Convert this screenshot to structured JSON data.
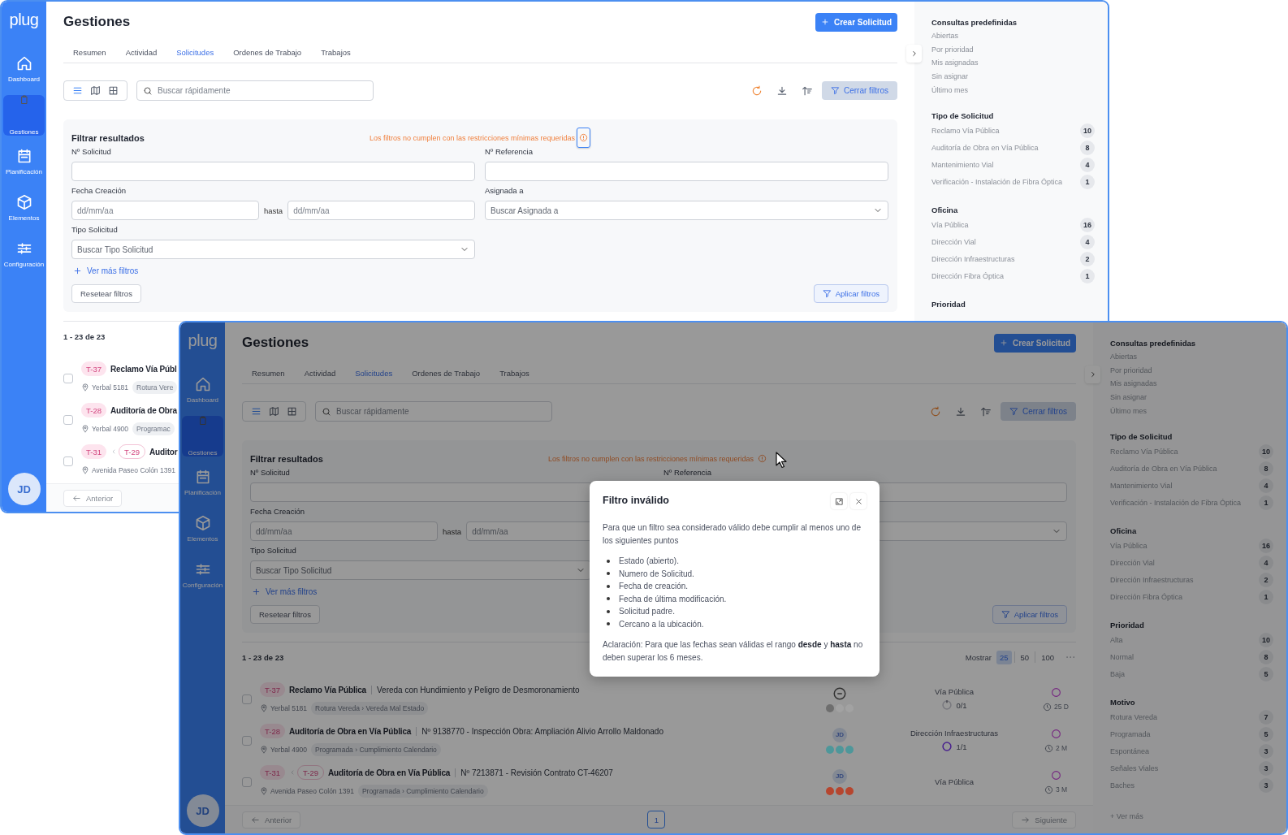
{
  "windows": [
    {
      "logo": "plug",
      "nav": [
        {
          "label": "Dashboard",
          "selected": false
        },
        {
          "label": "Gestiones",
          "selected": true
        },
        {
          "label": "Planificación",
          "selected": false
        },
        {
          "label": "Elementos",
          "selected": false
        },
        {
          "label": "Configuración",
          "selected": false
        }
      ],
      "avatar": "JD",
      "title": "Gestiones",
      "create_button": "Crear Solicitud",
      "tabs": [
        {
          "label": "Resumen",
          "selected": false
        },
        {
          "label": "Actividad",
          "selected": false
        },
        {
          "label": "Solicitudes",
          "selected": true
        },
        {
          "label": "Ordenes de Trabajo",
          "selected": false
        },
        {
          "label": "Trabajos",
          "selected": false
        }
      ],
      "search": {
        "placeholder": "Buscar rápidamente"
      },
      "filter_toggle": "Cerrar filtros",
      "filters": {
        "title": "Filtrar resultados",
        "warning": "Los filtros no cumplen con las restricciones mínimas requeridas",
        "warning_focused": true,
        "fields": [
          {
            "kind": "text",
            "label": "Nº Solicitud"
          },
          {
            "kind": "text",
            "label": "Nº Referencia"
          },
          {
            "kind": "date_range",
            "label": "Fecha Creación",
            "from_placeholder": "dd/mm/aa",
            "separator": "hasta",
            "to_placeholder": "dd/mm/aa"
          },
          {
            "kind": "select",
            "label": "Asignada a",
            "placeholder": "Buscar Asignada a"
          },
          {
            "kind": "select",
            "label": "Tipo Solicitud",
            "placeholder": "Buscar Tipo Solicitud"
          }
        ],
        "more": "Ver más filtros",
        "reset": "Resetear filtros",
        "apply": "Aplicar filtros"
      },
      "results": {
        "count": "1 - 23 de 23"
      },
      "rows": [
        {
          "checked": false,
          "tags": [
            {
              "label": "T-37",
              "kind": "own"
            }
          ],
          "title": "Reclamo Vía Públ",
          "location": "Yerbal 5181",
          "category": "Rotura Vere"
        },
        {
          "checked": false,
          "tags": [
            {
              "label": "T-28",
              "kind": "own"
            }
          ],
          "title": "Auditoría de Obra",
          "location": "Yerbal 4900",
          "category": "Programac"
        },
        {
          "checked": false,
          "tags": [
            {
              "label": "T-31",
              "kind": "own"
            },
            {
              "label": "T-29",
              "kind": "parent"
            }
          ],
          "title": "Auditor",
          "location": "Avenida Paseo Colón 1391"
        }
      ],
      "pagination": {
        "previous": {
          "label": "Anterior",
          "disabled": true
        }
      },
      "side_panel": {
        "sections": [
          {
            "title": "Consultas predefinidas",
            "items": [
              {
                "label": "Abiertas"
              },
              {
                "label": "Por prioridad"
              },
              {
                "label": "Mis asignadas"
              },
              {
                "label": "Sin asignar"
              },
              {
                "label": "Último mes"
              }
            ]
          },
          {
            "title": "Tipo de Solicitud",
            "items": [
              {
                "label": "Reclamo Vía Pública",
                "count": "10"
              },
              {
                "label": "Auditoría de Obra en Vía Pública",
                "count": "8"
              },
              {
                "label": "Mantenimiento Vial",
                "count": "4"
              },
              {
                "label": "Verificación - Instalación de Fibra Óptica",
                "count": "1"
              }
            ]
          },
          {
            "title": "Oficina",
            "items": [
              {
                "label": "Vía Pública",
                "count": "16"
              },
              {
                "label": "Dirección Vial",
                "count": "4"
              },
              {
                "label": "Dirección Infraestructuras",
                "count": "2"
              },
              {
                "label": "Dirección Fibra Óptica",
                "count": "1"
              }
            ]
          },
          {
            "title": "Prioridad"
          }
        ]
      }
    },
    {
      "logo": "plug",
      "nav": [
        {
          "label": "Dashboard",
          "selected": false
        },
        {
          "label": "Gestiones",
          "selected": true
        },
        {
          "label": "Planificación",
          "selected": false
        },
        {
          "label": "Elementos",
          "selected": false
        },
        {
          "label": "Configuración",
          "selected": false
        }
      ],
      "avatar": "JD",
      "title": "Gestiones",
      "create_button": "Crear Solicitud",
      "tabs": [
        {
          "label": "Resumen",
          "selected": false
        },
        {
          "label": "Actividad",
          "selected": false
        },
        {
          "label": "Solicitudes",
          "selected": true
        },
        {
          "label": "Ordenes de Trabajo",
          "selected": false
        },
        {
          "label": "Trabajos",
          "selected": false
        }
      ],
      "search": {
        "placeholder": "Buscar rápidamente"
      },
      "filter_toggle": "Cerrar filtros",
      "filters": {
        "title": "Filtrar resultados",
        "warning": "Los filtros no cumplen con las restricciones mínimas requeridas",
        "warning_focused": false,
        "fields": [
          {
            "kind": "text",
            "label": "Nº Solicitud"
          },
          {
            "kind": "text",
            "label": "Nº Referencia"
          },
          {
            "kind": "date_range",
            "label": "Fecha Creación",
            "from_placeholder": "dd/mm/aa",
            "separator": "hasta",
            "to_placeholder": "dd/mm/aa"
          },
          {
            "kind": "select"
          },
          {
            "kind": "select",
            "label": "Tipo Solicitud",
            "placeholder": "Buscar Tipo Solicitud"
          }
        ],
        "more": "Ver más filtros",
        "reset": "Resetear filtros",
        "apply": "Aplicar filtros"
      },
      "results": {
        "count": "1 - 23 de 23",
        "show_label": "Mostrar",
        "page_sizes": [
          {
            "label": "25",
            "selected": true
          },
          {
            "label": "50",
            "selected": false
          },
          {
            "label": "100",
            "selected": false
          }
        ]
      },
      "rows": [
        {
          "checked": false,
          "tags": [
            {
              "label": "T-37",
              "kind": "own"
            }
          ],
          "title": "Reclamo Vía Pública",
          "description": "Vereda con Hundimiento y Peligro de Desmoronamiento",
          "location": "Yerbal 5181",
          "category": "Rotura Vereda › Vereda Mal Estado",
          "assignee": {
            "kind": "unassigned"
          },
          "dots": [
            {
              "color": "#6e6e6e"
            },
            {
              "color": "#a2a2a2"
            },
            {
              "color": "#a2a2a2"
            }
          ],
          "office": "Vía Pública",
          "progress": {
            "label": "0/1",
            "complete": false
          },
          "age": "25 D"
        },
        {
          "checked": false,
          "tags": [
            {
              "label": "T-28",
              "kind": "own"
            }
          ],
          "title": "Auditoría de Obra en Vía Pública",
          "description": "Nº 9138770 - Inspección Obra: Ampliación Alivio Arrollo Maldonado",
          "location": "Yerbal 4900",
          "category": "Programada › Cumplimiento Calendario",
          "assignee": {
            "kind": "avatar",
            "initials": "JD"
          },
          "dots": [
            {
              "color": "#4e979a"
            },
            {
              "color": "#4e979a"
            },
            {
              "color": "#4e979a"
            }
          ],
          "office": "Dirección Infraestructuras",
          "progress": {
            "label": "1/1",
            "complete": true
          },
          "age": "2 M"
        },
        {
          "checked": false,
          "tags": [
            {
              "label": "T-31",
              "kind": "own"
            },
            {
              "label": "T-29",
              "kind": "parent"
            }
          ],
          "title": "Auditoría de Obra en Vía Pública",
          "description": "Nº 7213871 - Revisión Contrato CT-46207",
          "location": "Avenida Paseo Colón 1391",
          "category": "Programada › Cumplimiento Calendario",
          "assignee": {
            "kind": "avatar",
            "initials": "JD"
          },
          "dots": [
            {
              "color": "#b6462f"
            },
            {
              "color": "#b6462f"
            },
            {
              "color": "#b6462f"
            }
          ],
          "office": "Vía Pública",
          "age": "3 M"
        }
      ],
      "pagination": {
        "previous": {
          "label": "Anterior",
          "disabled": true
        },
        "pages": [
          {
            "label": "1",
            "selected": true
          }
        ],
        "next": {
          "label": "Siguiente",
          "disabled": true
        }
      },
      "side_panel": {
        "sections": [
          {
            "title": "Consultas predefinidas",
            "items": [
              {
                "label": "Abiertas"
              },
              {
                "label": "Por prioridad"
              },
              {
                "label": "Mis asignadas"
              },
              {
                "label": "Sin asignar"
              },
              {
                "label": "Último mes"
              }
            ]
          },
          {
            "title": "Tipo de Solicitud",
            "items": [
              {
                "label": "Reclamo Vía Pública",
                "count": "10"
              },
              {
                "label": "Auditoría de Obra en Vía Pública",
                "count": "8"
              },
              {
                "label": "Mantenimiento Vial",
                "count": "4"
              },
              {
                "label": "Verificación - Instalación de Fibra Óptica",
                "count": "1"
              }
            ]
          },
          {
            "title": "Oficina",
            "items": [
              {
                "label": "Vía Pública",
                "count": "16"
              },
              {
                "label": "Dirección Vial",
                "count": "4"
              },
              {
                "label": "Dirección Infraestructuras",
                "count": "2"
              },
              {
                "label": "Dirección Fibra Óptica",
                "count": "1"
              }
            ]
          },
          {
            "title": "Prioridad",
            "items": [
              {
                "label": "Alta",
                "count": "10"
              },
              {
                "label": "Normal",
                "count": "8"
              },
              {
                "label": "Baja",
                "count": "5"
              }
            ]
          },
          {
            "title": "Motivo",
            "items": [
              {
                "label": "Rotura Vereda",
                "count": "7"
              },
              {
                "label": "Programada",
                "count": "5"
              },
              {
                "label": "Espontánea",
                "count": "3"
              },
              {
                "label": "Señales Viales",
                "count": "3"
              },
              {
                "label": "Baches",
                "count": "3"
              }
            ]
          }
        ],
        "more": "+ Ver más"
      },
      "dialog": {
        "title": "Filtro inválido",
        "intro": "Para que un filtro sea considerado válido debe cumplir al menos uno de los siguientes puntos",
        "points": [
          "Estado (abierto).",
          "Numero de Solicitud.",
          "Fecha de creación.",
          "Fecha de última modificación.",
          "Solicitud padre.",
          "Cercano a la ubicación."
        ],
        "note": "Aclaración: Para que las fechas sean válidas el rango **desde** y **hasta** no deben superar los 6 meses."
      }
    }
  ]
}
